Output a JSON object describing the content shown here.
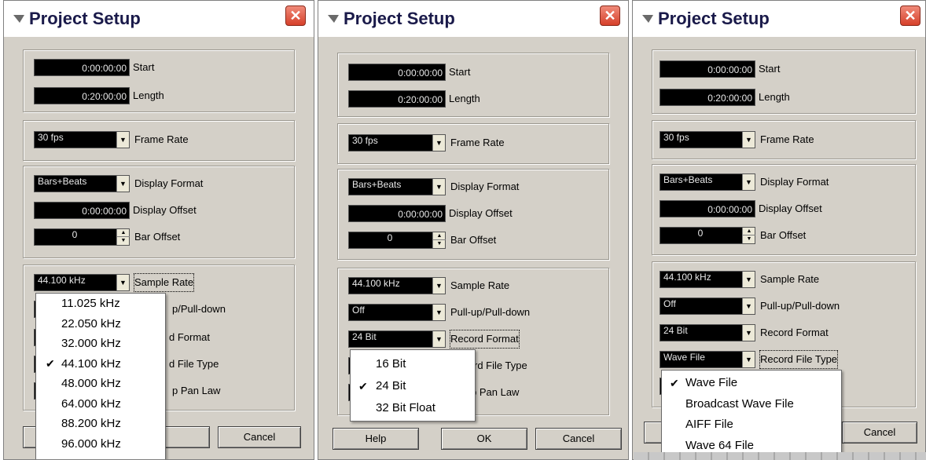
{
  "windows": [
    {
      "title": "Project Setup",
      "close_glyph": "✕",
      "start": {
        "value": "0:00:00:00",
        "label": "Start"
      },
      "length": {
        "value": "0:20:00:00",
        "label": "Length"
      },
      "frame_rate": {
        "value": "30 fps",
        "label": "Frame Rate"
      },
      "display_format": {
        "value": "Bars+Beats",
        "label": "Display Format"
      },
      "display_offset": {
        "value": "0:00:00:00",
        "label": "Display Offset"
      },
      "bar_offset": {
        "value": "0",
        "label": "Bar Offset"
      },
      "sample_rate": {
        "value": "44.100 kHz",
        "label": "Sample Rate"
      },
      "peek_labels": [
        "p/Pull-down",
        "d Format",
        "d File Type",
        "p Pan Law"
      ],
      "ok_label": "OK",
      "ok_peek": "K",
      "cancel_label": "Cancel",
      "menu": {
        "options": [
          "11.025 kHz",
          "22.050 kHz",
          "32.000 kHz",
          "44.100 kHz",
          "48.000 kHz",
          "64.000 kHz",
          "88.200 kHz",
          "96.000 kHz"
        ],
        "checked_index": 3
      }
    },
    {
      "title": "Project Setup",
      "close_glyph": "✕",
      "start": {
        "value": "0:00:00:00",
        "label": "Start"
      },
      "length": {
        "value": "0:20:00:00",
        "label": "Length"
      },
      "frame_rate": {
        "value": "30 fps",
        "label": "Frame Rate"
      },
      "display_format": {
        "value": "Bars+Beats",
        "label": "Display Format"
      },
      "display_offset": {
        "value": "0:00:00:00",
        "label": "Display Offset"
      },
      "bar_offset": {
        "value": "0",
        "label": "Bar Offset"
      },
      "sample_rate": {
        "value": "44.100 kHz",
        "label": "Sample Rate"
      },
      "pullup": {
        "value": "Off",
        "label": "Pull-up/Pull-down"
      },
      "record_format": {
        "value": "24 Bit",
        "label": "Record Format"
      },
      "peek_labels": [
        "rd File Type",
        "p Pan Law"
      ],
      "help_label": "Help",
      "ok_label": "OK",
      "cancel_label": "Cancel",
      "menu": {
        "options": [
          "16 Bit",
          "24 Bit",
          "32 Bit Float"
        ],
        "checked_index": 1
      }
    },
    {
      "title": "Project Setup",
      "close_glyph": "✕",
      "start": {
        "value": "0:00:00:00",
        "label": "Start"
      },
      "length": {
        "value": "0:20:00:00",
        "label": "Length"
      },
      "frame_rate": {
        "value": "30 fps",
        "label": "Frame Rate"
      },
      "display_format": {
        "value": "Bars+Beats",
        "label": "Display Format"
      },
      "display_offset": {
        "value": "0:00:00:00",
        "label": "Display Offset"
      },
      "bar_offset": {
        "value": "0",
        "label": "Bar Offset"
      },
      "sample_rate": {
        "value": "44.100 kHz",
        "label": "Sample Rate"
      },
      "pullup": {
        "value": "Off",
        "label": "Pull-up/Pull-down"
      },
      "record_format": {
        "value": "24 Bit",
        "label": "Record Format"
      },
      "record_file_type": {
        "value": "Wave File",
        "label": "Record File Type"
      },
      "cancel_label": "Cancel",
      "menu": {
        "options": [
          "Wave File",
          "Broadcast Wave File",
          "AIFF File",
          "Wave 64 File"
        ],
        "checked_index": 0
      }
    }
  ],
  "glyphs": {
    "check": "✔",
    "arrow_down": "▼",
    "spin_up": "▲",
    "spin_down": "▼"
  }
}
